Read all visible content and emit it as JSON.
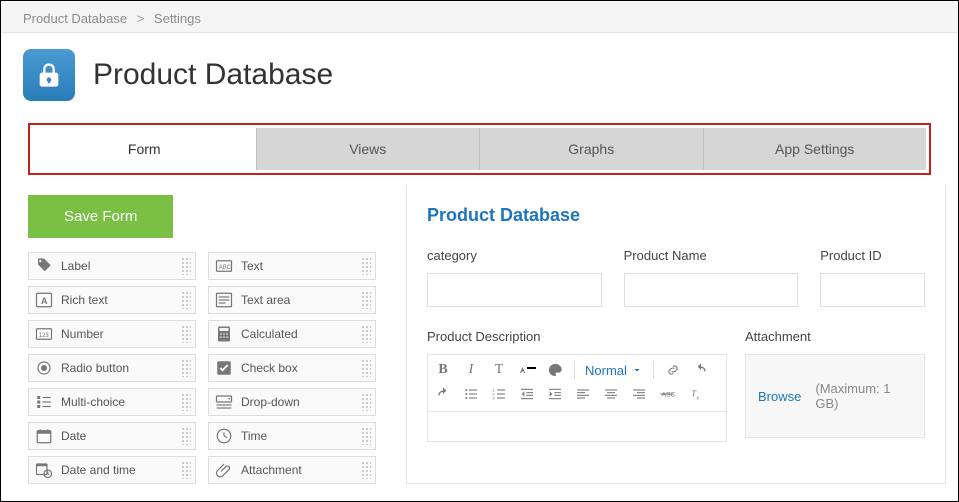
{
  "breadcrumb": {
    "root": "Product Database",
    "current": "Settings"
  },
  "header": {
    "title": "Product Database"
  },
  "tabs": {
    "form": "Form",
    "views": "Views",
    "graphs": "Graphs",
    "app_settings": "App Settings"
  },
  "save_button": "Save Form",
  "field_types": {
    "label": "Label",
    "text": "Text",
    "rich_text": "Rich text",
    "text_area": "Text area",
    "number": "Number",
    "calculated": "Calculated",
    "radio": "Radio button",
    "checkbox": "Check box",
    "multichoice": "Multi-choice",
    "dropdown": "Drop-down",
    "date": "Date",
    "time": "Time",
    "datetime": "Date and time",
    "attachment": "Attachment"
  },
  "form": {
    "title": "Product Database",
    "category_label": "category",
    "product_name_label": "Product Name",
    "product_id_label": "Product ID",
    "description_label": "Product Description",
    "attachment_label": "Attachment"
  },
  "editor": {
    "size_label": "Normal"
  },
  "attachment": {
    "browse": "Browse",
    "limit": "(Maximum: 1 GB)"
  }
}
